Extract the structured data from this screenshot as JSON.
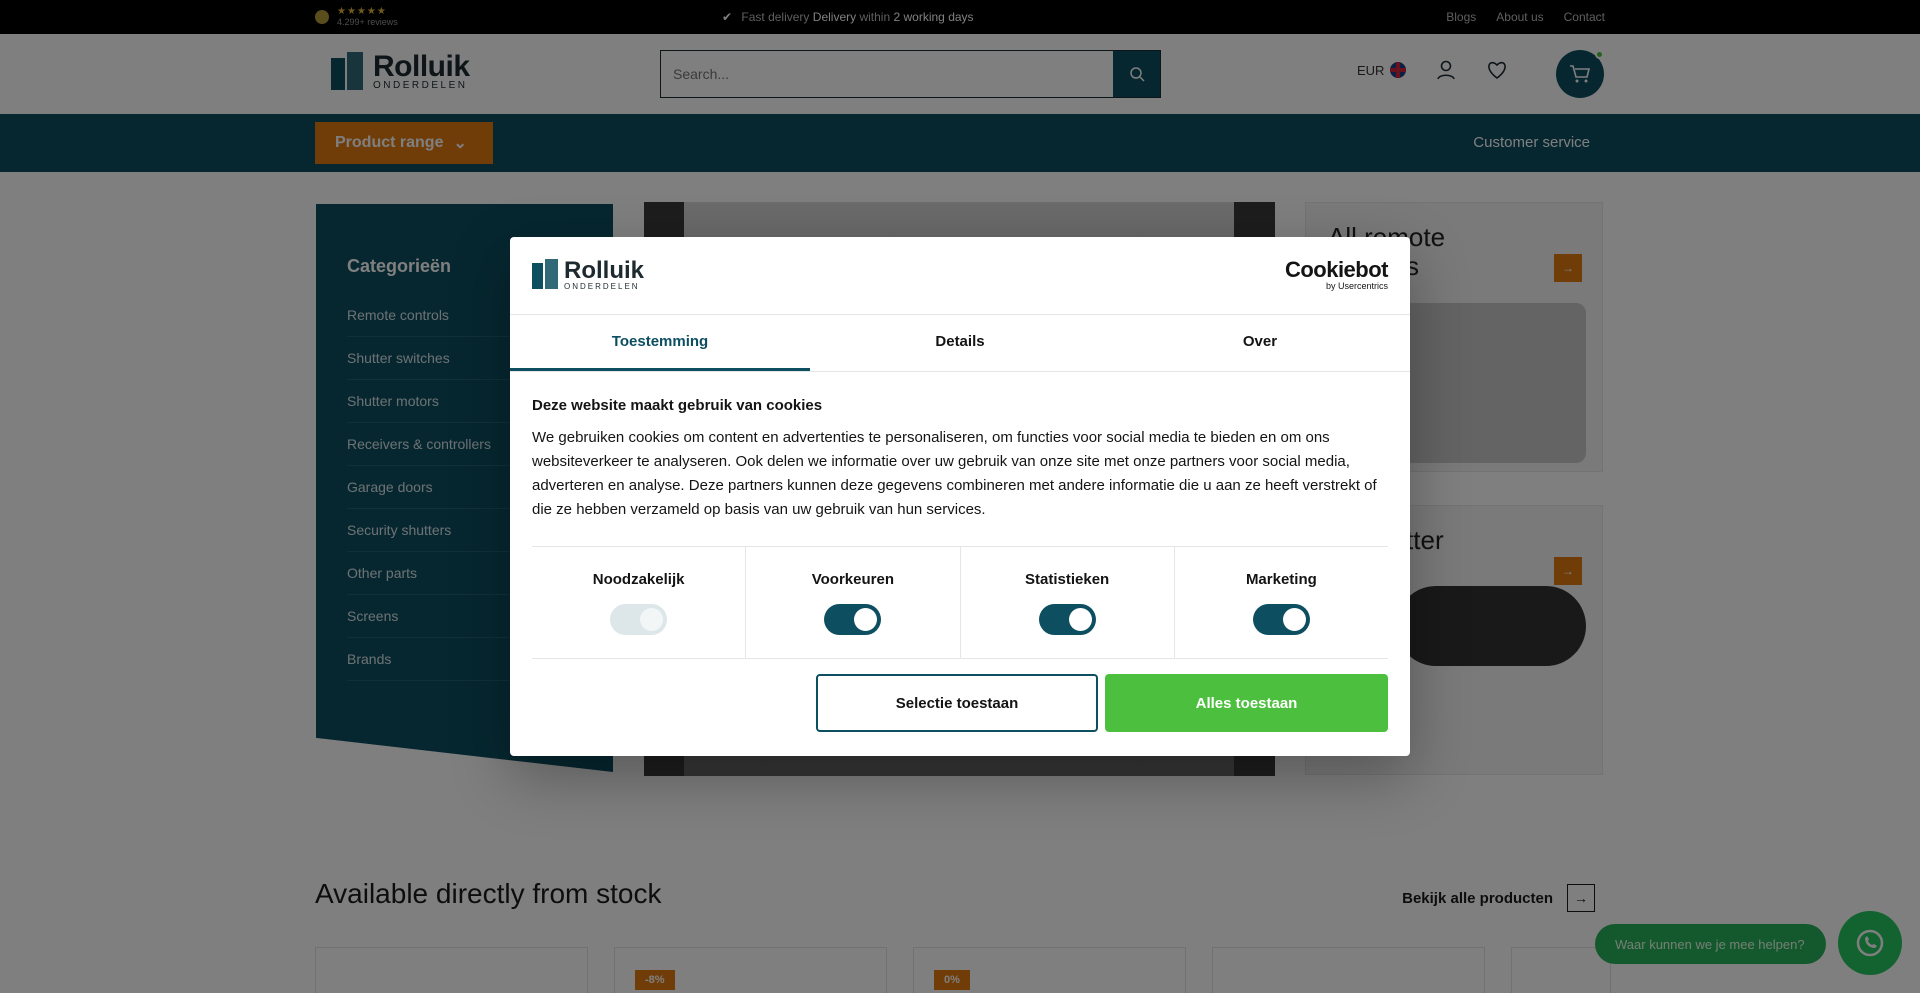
{
  "topbar": {
    "rating_stars": "★★★★★",
    "reviews": "4.299+ reviews",
    "delivery_pre": "Fast delivery",
    "delivery_mid": "Delivery",
    "delivery_post": "within",
    "delivery_days": "2 working days",
    "links": [
      "Blogs",
      "About us",
      "Contact"
    ]
  },
  "header": {
    "brand": "Rolluik",
    "brand_sub": "ONDERDELEN",
    "search_placeholder": "Search...",
    "currency": "EUR"
  },
  "nav": {
    "product_range": "Product range",
    "customer_service": "Customer service"
  },
  "categories": {
    "title": "Categorieën",
    "items": [
      "Remote controls",
      "Shutter switches",
      "Shutter motors",
      "Receivers & controllers",
      "Garage doors",
      "Security shutters",
      "Other parts",
      "Screens",
      "Brands"
    ]
  },
  "tiles": {
    "tile1_title": "All remote controls",
    "tile2_title": "All shutter motors"
  },
  "section": {
    "title": "Available directly from stock",
    "see_all": "Bekijk alle producten",
    "badges": [
      "-8%",
      "0%"
    ]
  },
  "whatsapp": {
    "bubble": "Waar kunnen we je mee helpen?"
  },
  "cookie": {
    "brand": "Rolluik",
    "brand_sub": "ONDERDELEN",
    "cookiebot": "Cookiebot",
    "cookiebot_by": "by Usercentrics",
    "tabs": [
      "Toestemming",
      "Details",
      "Over"
    ],
    "heading": "Deze website maakt gebruik van cookies",
    "body": "We gebruiken cookies om content en advertenties te personaliseren, om functies voor social media te bieden en om ons websiteverkeer te analyseren. Ook delen we informatie over uw gebruik van onze site met onze partners voor social media, adverteren en analyse. Deze partners kunnen deze gegevens combineren met andere informatie die u aan ze heeft verstrekt of die ze hebben verzameld op basis van uw gebruik van hun services.",
    "toggles": [
      {
        "label": "Noodzakelijk",
        "on": true,
        "disabled": true
      },
      {
        "label": "Voorkeuren",
        "on": true,
        "disabled": false
      },
      {
        "label": "Statistieken",
        "on": true,
        "disabled": false
      },
      {
        "label": "Marketing",
        "on": true,
        "disabled": false
      }
    ],
    "btn_selection": "Selectie toestaan",
    "btn_all": "Alles toestaan"
  },
  "colors": {
    "primary": "#0d4f61",
    "accent": "#e07b12",
    "accept": "#4dbf3f"
  }
}
